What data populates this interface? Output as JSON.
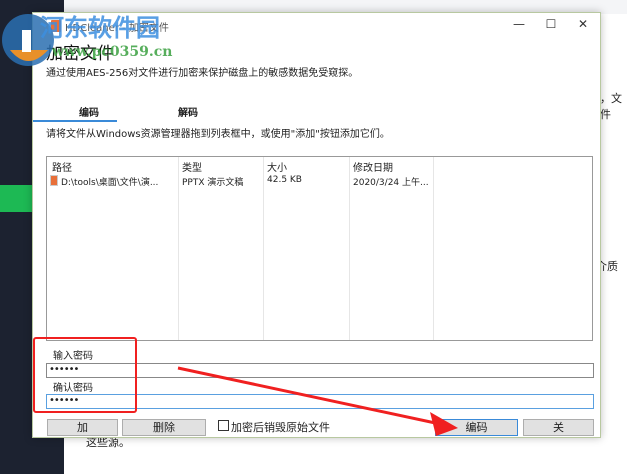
{
  "window": {
    "title": "HDCleaner - 加密文件"
  },
  "heading": "加密文件",
  "description": "通过使用AES-256对文件进行加密来保护磁盘上的敏感数据免受窥探。",
  "tabs": [
    {
      "label": "编码",
      "active": true
    },
    {
      "label": "解码",
      "active": false
    }
  ],
  "instruction": "请将文件从Windows资源管理器拖到列表框中，或使用\"添加\"按钮添加它们。",
  "file_list": {
    "columns": [
      "路径",
      "类型",
      "大小",
      "修改日期"
    ],
    "rows": [
      {
        "path": "D:\\tools\\桌面\\文件\\演...",
        "type": "PPTX 演示文稿",
        "size": "42.5 KB",
        "modified": "2020/3/24 上午..."
      }
    ]
  },
  "password": {
    "label": "输入密码",
    "value": "••••••"
  },
  "confirm": {
    "label": "确认密码",
    "value": "••••••"
  },
  "buttons": {
    "add": "加",
    "delete": "删除",
    "encode": "编码",
    "close": "关"
  },
  "checkbox": {
    "label": "加密后销毁原始文件",
    "checked": false
  },
  "background": {
    "text1": "，文件",
    "text2": "介质",
    "text3": "这些源。"
  },
  "watermark": {
    "name": "河东软件园",
    "url": "www.pc0359.cn"
  },
  "colors": {
    "accent": "#3a8ad8",
    "annotation": "#f02020",
    "sidebar": "#1c2230",
    "green": "#1db954"
  }
}
